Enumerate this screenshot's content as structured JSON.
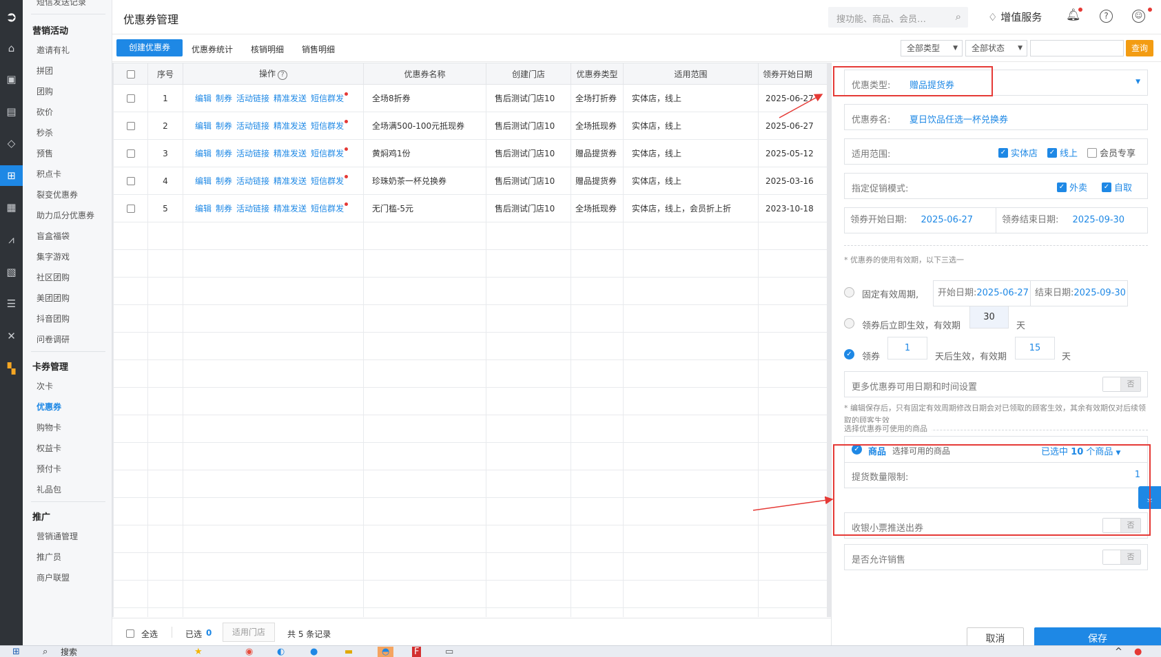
{
  "header": {
    "title": "优惠券管理",
    "search_placeholder": "搜功能、商品、会员…",
    "value_added": "增值服务"
  },
  "menu": {
    "top_cut": "短信发送记录",
    "sections": [
      {
        "title": "营销活动",
        "items": [
          "邀请有礼",
          "拼团",
          "团购",
          "砍价",
          "秒杀",
          "预售",
          "积点卡",
          "裂变优惠券",
          "助力瓜分优惠券",
          "盲盒福袋",
          "集字游戏",
          "社区团购",
          "美团团购",
          "抖音团购",
          "问卷调研"
        ]
      },
      {
        "title": "卡券管理",
        "items": [
          "次卡",
          "优惠券",
          "购物卡",
          "权益卡",
          "预付卡",
          "礼品包"
        ]
      },
      {
        "title": "推广",
        "items": [
          "营销通管理",
          "推广员",
          "商户联盟"
        ]
      }
    ],
    "active_item": "优惠券"
  },
  "toolbar": {
    "create_label": "创建优惠券",
    "tabs": [
      "优惠券统计",
      "核销明细",
      "销售明细"
    ],
    "filter_type": "全部类型",
    "filter_status": "全部状态",
    "query_label": "查询"
  },
  "table": {
    "headers": [
      "序号",
      "操作",
      "优惠券名称",
      "创建门店",
      "优惠券类型",
      "适用范围",
      "领券开始日期"
    ],
    "op_labels": [
      "编辑",
      "制券",
      "活动链接",
      "精准发送",
      "短信群发"
    ],
    "rows": [
      {
        "no": "1",
        "name": "全场8折券",
        "store": "售后测试门店10",
        "type": "全场打折券",
        "scope": "实体店，线上",
        "start": "2025-06-27"
      },
      {
        "no": "2",
        "name": "全场满500-100元抵现券",
        "store": "售后测试门店10",
        "type": "全场抵现券",
        "scope": "实体店，线上",
        "start": "2025-06-27"
      },
      {
        "no": "3",
        "name": "黄焖鸡1份",
        "store": "售后测试门店10",
        "type": "赠品提货券",
        "scope": "实体店，线上",
        "start": "2025-05-12"
      },
      {
        "no": "4",
        "name": "珍珠奶茶一杯兑换券",
        "store": "售后测试门店10",
        "type": "赠品提货券",
        "scope": "实体店，线上",
        "start": "2025-03-16"
      },
      {
        "no": "5",
        "name": "无门槛-5元",
        "store": "售后测试门店10",
        "type": "全场抵现券",
        "scope": "实体店，线上，会员折上折",
        "start": "2023-10-18"
      }
    ]
  },
  "footer": {
    "select_all": "全选",
    "selected_label": "已选",
    "selected_count": "0",
    "apply_store": "适用门店",
    "total": "共 5 条记录"
  },
  "panel": {
    "coupon_type_label": "优惠类型:",
    "coupon_type_value": "赠品提货券",
    "coupon_name_label": "优惠券名:",
    "coupon_name_value": "夏日饮品任选一杯兑换券",
    "scope_label": "适用范围:",
    "scope_opts": [
      "实体店",
      "线上",
      "会员专享"
    ],
    "promo_label": "指定促销模式:",
    "promo_opts": [
      "外卖",
      "自取"
    ],
    "claim_start_label": "领券开始日期:",
    "claim_start_value": "2025-06-27",
    "claim_end_label": "领券结束日期:",
    "claim_end_value": "2025-09-30",
    "validity_note": "* 优惠券的使用有效期，以下三选一",
    "fixed_label": "固定有效周期,",
    "fixed_start_label": "开始日期:",
    "fixed_start_value": "2025-06-27",
    "fixed_end_label": "结束日期:",
    "fixed_end_value": "2025-09-30",
    "immediate_label": "领券后立即生效，有效期",
    "immediate_days": "30",
    "day_unit": "天",
    "claim_label": "领券",
    "claim_delay": "1",
    "claim_mid": "天后生效，有效期",
    "claim_days": "15",
    "more_label": "更多优惠券可用日期和时间设置",
    "toggle_no": "否",
    "edit_note": "* 编辑保存后，只有固定有效周期修改日期会对已领取的顾客生效，其余有效期仅对后续领取的顾客生效",
    "goods_section": "选择优惠券可使用的商品",
    "goods_label": "商品",
    "goods_hint": "选择可用的商品",
    "goods_selected_prefix": "已选中",
    "goods_selected_count": "10",
    "goods_selected_suffix": "个商品",
    "pickup_limit_label": "提货数量限制:",
    "pickup_limit_value": "1",
    "receipt_label": "收银小票推送出券",
    "allow_sale_label": "是否允许销售",
    "cancel_label": "取消",
    "save_label": "保存"
  },
  "taskbar": {
    "search": "搜索"
  }
}
